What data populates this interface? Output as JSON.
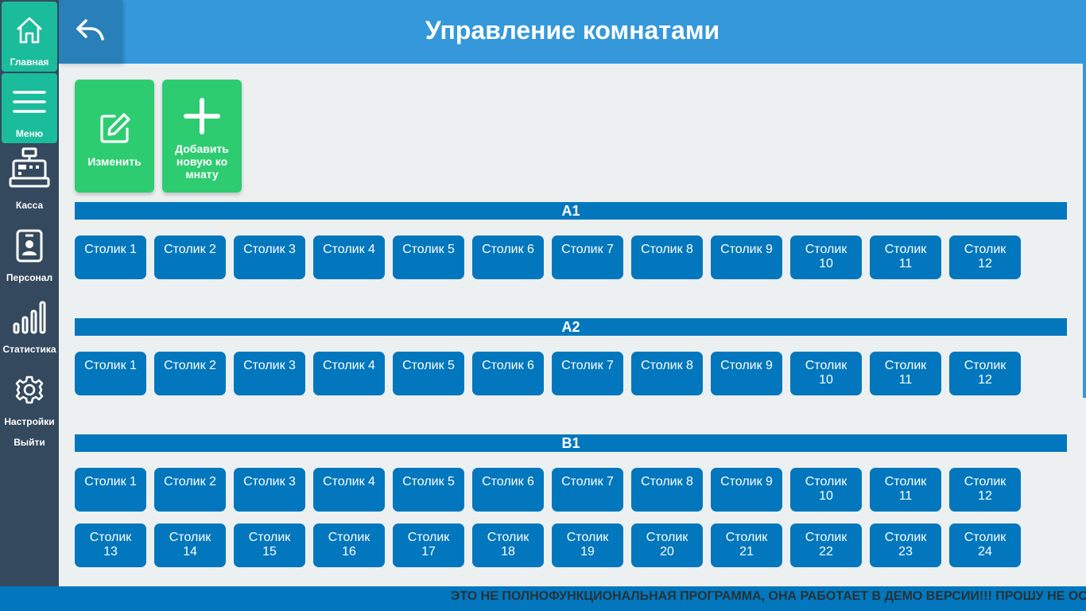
{
  "sidebar": {
    "items": [
      {
        "label": "Главная",
        "icon": "home-icon",
        "active": true
      },
      {
        "label": "Меню",
        "icon": "menu-icon",
        "active": true
      },
      {
        "label": "Касса",
        "icon": "cash-register-icon",
        "active": false
      },
      {
        "label": "Персонал",
        "icon": "badge-icon",
        "active": false
      },
      {
        "label": "Статистика",
        "icon": "bar-chart-icon",
        "active": false
      },
      {
        "label": "Настройки",
        "icon": "gear-icon",
        "active": false
      }
    ],
    "logout_label": "Выйти"
  },
  "header": {
    "title": "Управление комнатами",
    "back_icon": "back-arrow-icon"
  },
  "actions": {
    "edit_label": "Изменить",
    "add_label_line1": "Добавить",
    "add_label_line2": "новую ко",
    "add_label_line3": "мнату"
  },
  "rooms": [
    {
      "name": "A1",
      "tables": [
        {
          "l1": "Столик 1",
          "l2": ""
        },
        {
          "l1": "Столик 2",
          "l2": ""
        },
        {
          "l1": "Столик 3",
          "l2": ""
        },
        {
          "l1": "Столик 4",
          "l2": ""
        },
        {
          "l1": "Столик 5",
          "l2": ""
        },
        {
          "l1": "Столик 6",
          "l2": ""
        },
        {
          "l1": "Столик 7",
          "l2": ""
        },
        {
          "l1": "Столик 8",
          "l2": ""
        },
        {
          "l1": "Столик 9",
          "l2": ""
        },
        {
          "l1": "Столик",
          "l2": "10"
        },
        {
          "l1": "Столик",
          "l2": "11"
        },
        {
          "l1": "Столик",
          "l2": "12"
        }
      ]
    },
    {
      "name": "A2",
      "tables": [
        {
          "l1": "Столик 1",
          "l2": ""
        },
        {
          "l1": "Столик 2",
          "l2": ""
        },
        {
          "l1": "Столик 3",
          "l2": ""
        },
        {
          "l1": "Столик 4",
          "l2": ""
        },
        {
          "l1": "Столик 5",
          "l2": ""
        },
        {
          "l1": "Столик 6",
          "l2": ""
        },
        {
          "l1": "Столик 7",
          "l2": ""
        },
        {
          "l1": "Столик 8",
          "l2": ""
        },
        {
          "l1": "Столик 9",
          "l2": ""
        },
        {
          "l1": "Столик",
          "l2": "10"
        },
        {
          "l1": "Столик",
          "l2": "11"
        },
        {
          "l1": "Столик",
          "l2": "12"
        }
      ]
    },
    {
      "name": "B1",
      "tables": [
        {
          "l1": "Столик 1",
          "l2": ""
        },
        {
          "l1": "Столик 2",
          "l2": ""
        },
        {
          "l1": "Столик 3",
          "l2": ""
        },
        {
          "l1": "Столик 4",
          "l2": ""
        },
        {
          "l1": "Столик 5",
          "l2": ""
        },
        {
          "l1": "Столик 6",
          "l2": ""
        },
        {
          "l1": "Столик 7",
          "l2": ""
        },
        {
          "l1": "Столик 8",
          "l2": ""
        },
        {
          "l1": "Столик 9",
          "l2": ""
        },
        {
          "l1": "Столик",
          "l2": "10"
        },
        {
          "l1": "Столик",
          "l2": "11"
        },
        {
          "l1": "Столик",
          "l2": "12"
        },
        {
          "l1": "Столик",
          "l2": "13"
        },
        {
          "l1": "Столик",
          "l2": "14"
        },
        {
          "l1": "Столик",
          "l2": "15"
        },
        {
          "l1": "Столик",
          "l2": "16"
        },
        {
          "l1": "Столик",
          "l2": "17"
        },
        {
          "l1": "Столик",
          "l2": "18"
        },
        {
          "l1": "Столик",
          "l2": "19"
        },
        {
          "l1": "Столик",
          "l2": "20"
        },
        {
          "l1": "Столик",
          "l2": "21"
        },
        {
          "l1": "Столик",
          "l2": "22"
        },
        {
          "l1": "Столик",
          "l2": "23"
        },
        {
          "l1": "Столик",
          "l2": "24"
        }
      ]
    }
  ],
  "footer": {
    "marquee": "ЭТО НЕ ПОЛНОФУНКЦИОНАЛЬНАЯ ПРОГРАММА, ОНА РАБОТАЕТ В ДЕМО ВЕРСИИ!!! ПРОШУ НЕ ОС"
  },
  "colors": {
    "sidebar": "#34495e",
    "sidebar_active": "#1abc9c",
    "header": "#3498db",
    "back_button": "#2980b9",
    "action_green": "#2ecc71",
    "room_blue": "#0277bd",
    "background": "#ecf0f1"
  }
}
